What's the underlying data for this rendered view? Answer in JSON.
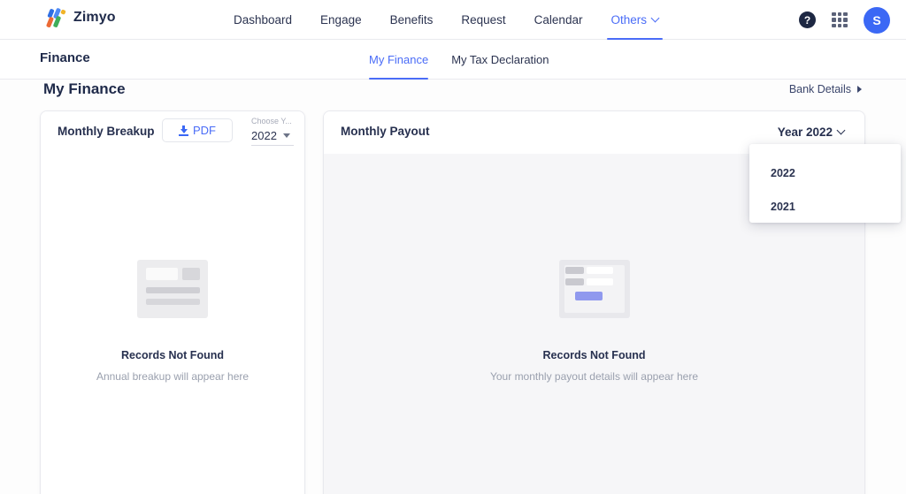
{
  "topbar": {
    "brand": "Zimyo",
    "brand_icon": "zimyo-logo-icon",
    "nav": [
      {
        "label": "Dashboard",
        "active": false,
        "has_chevron": false
      },
      {
        "label": "Engage",
        "active": false,
        "has_chevron": false
      },
      {
        "label": "Benefits",
        "active": false,
        "has_chevron": false
      },
      {
        "label": "Request",
        "active": false,
        "has_chevron": false
      },
      {
        "label": "Calendar",
        "active": false,
        "has_chevron": false
      },
      {
        "label": "Others",
        "active": true,
        "has_chevron": true
      }
    ],
    "help_label": "?",
    "help_icon": "help-circle-icon",
    "apps_icon": "apps-grid-icon",
    "avatar_initial": "S",
    "avatar_color": "#3b68f5"
  },
  "subbar": {
    "module_title": "Finance",
    "tabs": [
      {
        "label": "My Finance",
        "active": true
      },
      {
        "label": "My Tax Declaration",
        "active": false
      }
    ]
  },
  "page": {
    "title": "My Finance",
    "bank_details_label": "Bank Details",
    "bank_details_icon": "caret-right-icon"
  },
  "monthly_breakup": {
    "title": "Monthly Breakup",
    "pdf_button_label": "PDF",
    "pdf_icon": "download-icon",
    "year_field_label": "Choose Y...",
    "year_value": "2022",
    "year_caret_icon": "triangle-down-icon",
    "empty_title": "Records Not Found",
    "empty_subtitle": "Annual breakup will appear here",
    "empty_icon": "document-placeholder-icon"
  },
  "monthly_payout": {
    "title": "Monthly Payout",
    "year_button_label": "Year 2022",
    "year_caret_icon": "chevron-down-icon",
    "empty_title": "Records Not Found",
    "empty_subtitle": "Your monthly payout details will appear here",
    "empty_icon": "form-placeholder-icon",
    "dropdown_open": true,
    "dropdown_options": [
      {
        "label": "2022"
      },
      {
        "label": "2021"
      }
    ]
  },
  "colors": {
    "accent": "#4a6cf7",
    "text_dark": "#27304f",
    "muted": "#9aa0ae",
    "card_body_gray": "#f6f6f8"
  }
}
